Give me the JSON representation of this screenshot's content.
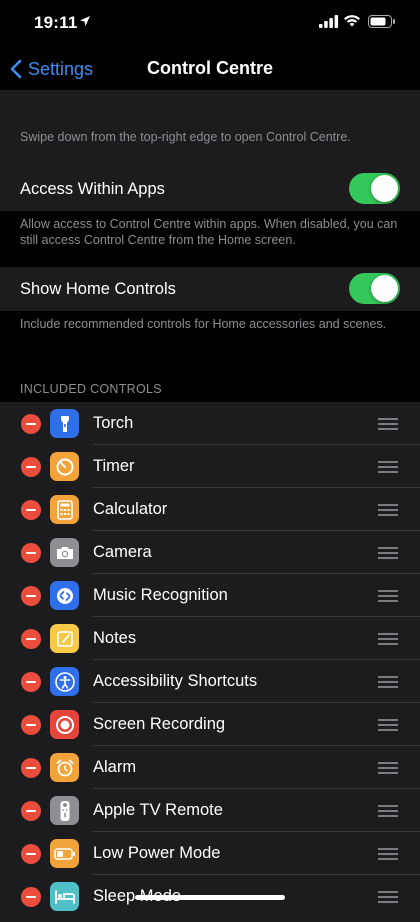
{
  "status_bar": {
    "time": "19:11"
  },
  "nav": {
    "back_label": "Settings",
    "title": "Control Centre"
  },
  "intro_note": "Swipe down from the top-right edge to open Control Centre.",
  "access_within_apps": {
    "label": "Access Within Apps",
    "on": true,
    "note": "Allow access to Control Centre within apps. When disabled, you can still access Control Centre from the Home screen."
  },
  "show_home_controls": {
    "label": "Show Home Controls",
    "on": true,
    "note": "Include recommended controls for Home accessories and scenes."
  },
  "included_controls": {
    "header": "INCLUDED CONTROLS",
    "items": [
      {
        "label": "Torch",
        "icon": "torch-icon",
        "color": "#2f6fea"
      },
      {
        "label": "Timer",
        "icon": "timer-icon",
        "color": "#f2a33a"
      },
      {
        "label": "Calculator",
        "icon": "calculator-icon",
        "color": "#f2a33a"
      },
      {
        "label": "Camera",
        "icon": "camera-icon",
        "color": "#8e8e93"
      },
      {
        "label": "Music Recognition",
        "icon": "shazam-icon",
        "color": "#2f6fea"
      },
      {
        "label": "Notes",
        "icon": "notes-icon",
        "color": "#f7c948"
      },
      {
        "label": "Accessibility Shortcuts",
        "icon": "accessibility-icon",
        "color": "#2f6fea"
      },
      {
        "label": "Screen Recording",
        "icon": "screen-recording-icon",
        "color": "#e5453a"
      },
      {
        "label": "Alarm",
        "icon": "alarm-icon",
        "color": "#f2a33a"
      },
      {
        "label": "Apple TV Remote",
        "icon": "tv-remote-icon",
        "color": "#8e8e93"
      },
      {
        "label": "Low Power Mode",
        "icon": "battery-icon",
        "color": "#f2a33a"
      },
      {
        "label": "Sleep Mode",
        "icon": "bed-icon",
        "color": "#4fc0c8"
      }
    ]
  }
}
